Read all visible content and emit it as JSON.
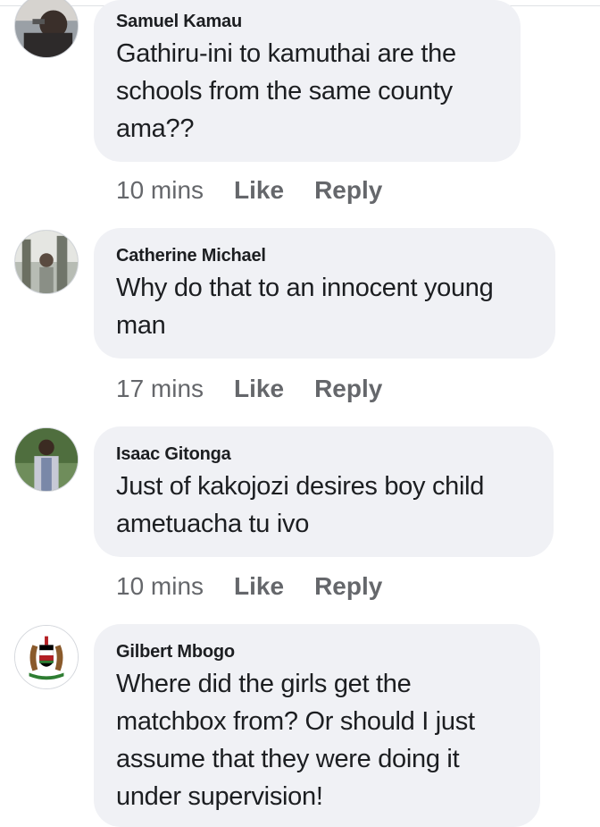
{
  "comments": [
    {
      "author": "Samuel Kamau",
      "text": "Gathiru-ini to kamuthai are the schools from the same county ama??",
      "time": "10 mins",
      "like_label": "Like",
      "reply_label": "Reply"
    },
    {
      "author": "Catherine Michael",
      "text": "Why do that to an innocent young man",
      "time": "17 mins",
      "like_label": "Like",
      "reply_label": "Reply"
    },
    {
      "author": "Isaac Gitonga",
      "text": "Just of kakojozi desires boy child ametuacha tu ivo",
      "time": "10 mins",
      "like_label": "Like",
      "reply_label": "Reply"
    },
    {
      "author": "Gilbert Mbogo",
      "text": "Where did the girls get the matchbox from? Or should I just assume that they were doing it under supervision!",
      "time": "",
      "like_label": "",
      "reply_label": ""
    }
  ],
  "colors": {
    "bubble": "#f0f1f5",
    "text": "#1c1e21",
    "meta": "#65676b"
  }
}
